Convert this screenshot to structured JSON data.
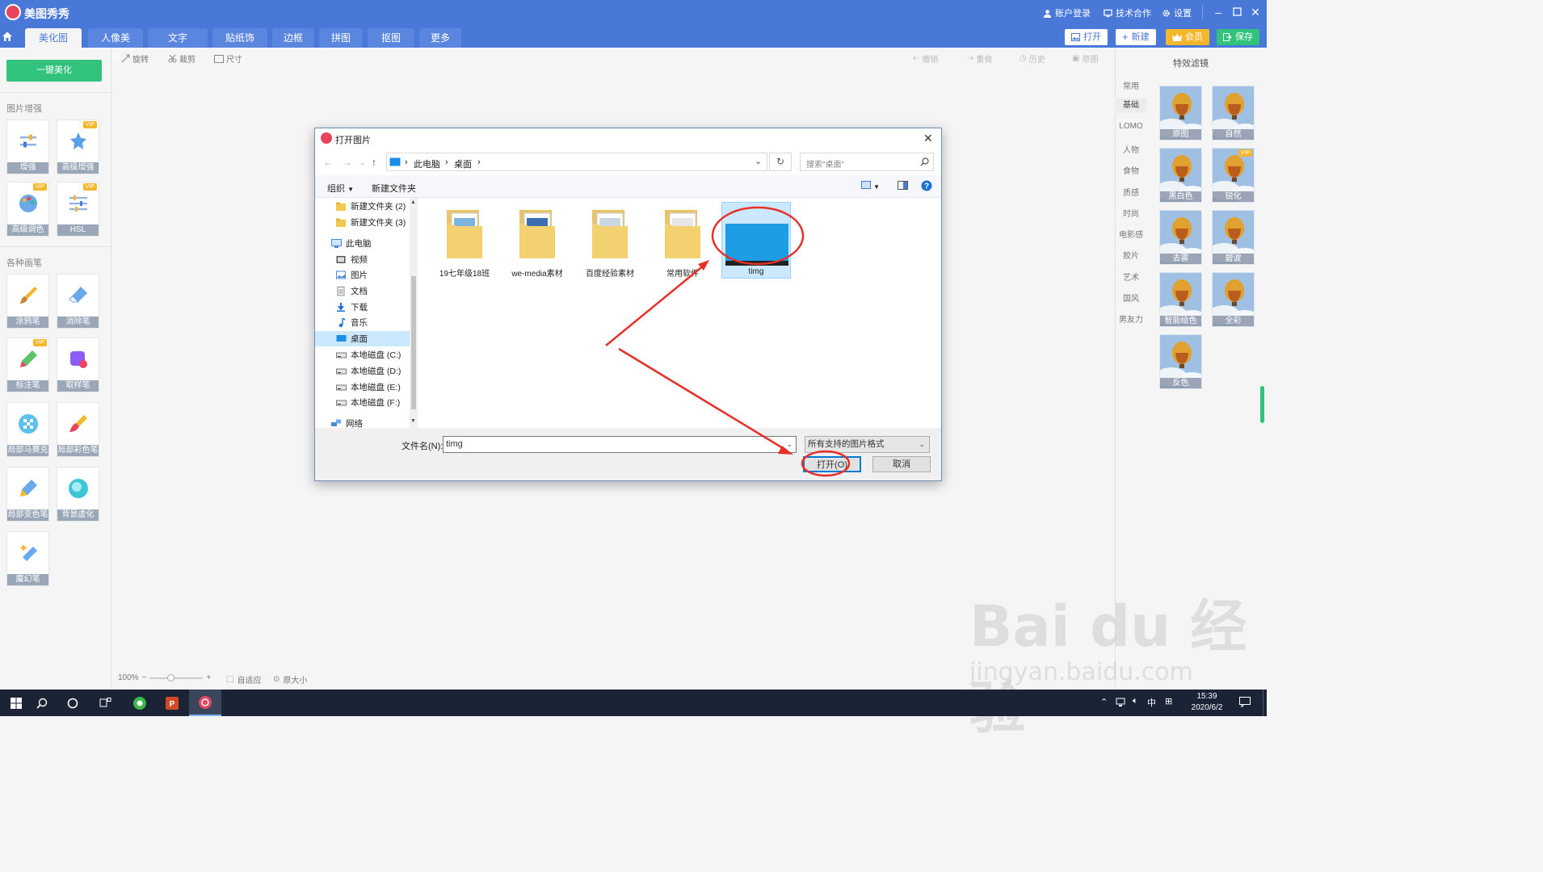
{
  "app": {
    "name": "美图秀秀",
    "account_login": "账户登录",
    "tech_coop": "技术合作",
    "settings": "设置"
  },
  "tabs": [
    "美化图片",
    "人像美容",
    "文字",
    "贴纸饰品",
    "边框",
    "拼图",
    "抠图",
    "更多"
  ],
  "top_buttons": {
    "open": "打开",
    "new": "新建",
    "vip": "会员",
    "save": "保存"
  },
  "toolbar": {
    "rotate": "旋转",
    "crop": "裁剪",
    "size": "尺寸",
    "undo": "撤销",
    "redo": "重做",
    "history": "历史",
    "original": "原图"
  },
  "left_panel": {
    "one_click": "一键美化",
    "section_enhance": "图片增强",
    "section_brush": "各种画笔",
    "enhance_tools": [
      {
        "label": "增强",
        "icon": "sliders-icon",
        "vip": false
      },
      {
        "label": "高级增强",
        "icon": "star-wand-icon",
        "vip": true
      },
      {
        "label": "高级调色",
        "icon": "palette-icon",
        "vip": true
      },
      {
        "label": "HSL",
        "icon": "hsl-sliders-icon",
        "vip": true
      }
    ],
    "brush_tools": [
      {
        "label": "涂鸦笔",
        "icon": "brush-icon",
        "vip": false
      },
      {
        "label": "消除笔",
        "icon": "eraser-icon",
        "vip": false
      },
      {
        "label": "标注笔",
        "icon": "marker-icon",
        "vip": true
      },
      {
        "label": "取样笔",
        "icon": "sample-icon",
        "vip": false
      },
      {
        "label": "局部马赛克",
        "icon": "mosaic-icon",
        "vip": false
      },
      {
        "label": "局部彩色笔",
        "icon": "color-brush-icon",
        "vip": false
      },
      {
        "label": "局部变色笔",
        "icon": "recolor-icon",
        "vip": false
      },
      {
        "label": "背景虚化",
        "icon": "blur-icon",
        "vip": false
      },
      {
        "label": "魔幻笔",
        "icon": "magic-pen-icon",
        "vip": false
      }
    ],
    "vip_tag": "VIP"
  },
  "right_panel": {
    "title": "特效滤镜",
    "categories": [
      "常用",
      "基础",
      "LOMO",
      "人物",
      "食物",
      "质感",
      "时尚",
      "电影感",
      "胶片",
      "艺术",
      "国风",
      "男友力"
    ],
    "active_category": "基础",
    "filters": [
      {
        "label": "原图",
        "vip": false
      },
      {
        "label": "自然",
        "vip": false
      },
      {
        "label": "黑白色",
        "vip": false
      },
      {
        "label": "锐化",
        "vip": true
      },
      {
        "label": "去雾",
        "vip": false
      },
      {
        "label": "碧波",
        "vip": false
      },
      {
        "label": "智能绘色",
        "vip": false
      },
      {
        "label": "全彩",
        "vip": false
      },
      {
        "label": "反色",
        "vip": false
      }
    ]
  },
  "zoom": {
    "percent": "100%",
    "minus": "−",
    "plus": "+",
    "fit": "自适应",
    "actual": "原大小"
  },
  "dialog": {
    "title": "打开图片",
    "path": [
      "此电脑",
      "桌面"
    ],
    "search_placeholder": "搜索\"桌面\"",
    "organize": "组织",
    "new_folder": "新建文件夹",
    "nav_items": [
      {
        "label": "新建文件夹 (2)",
        "icon": "folder-icon",
        "indent": 1
      },
      {
        "label": "新建文件夹 (3)",
        "icon": "folder-icon",
        "indent": 1
      },
      {
        "label": "此电脑",
        "icon": "computer-icon",
        "indent": 0
      },
      {
        "label": "视频",
        "icon": "video-icon",
        "indent": 1
      },
      {
        "label": "图片",
        "icon": "pictures-icon",
        "indent": 1
      },
      {
        "label": "文档",
        "icon": "document-icon",
        "indent": 1
      },
      {
        "label": "下载",
        "icon": "download-icon",
        "indent": 1
      },
      {
        "label": "音乐",
        "icon": "music-icon",
        "indent": 1
      },
      {
        "label": "桌面",
        "icon": "desktop-icon",
        "indent": 1,
        "selected": true
      },
      {
        "label": "本地磁盘 (C:)",
        "icon": "drive-icon",
        "indent": 1
      },
      {
        "label": "本地磁盘 (D:)",
        "icon": "drive-icon",
        "indent": 1
      },
      {
        "label": "本地磁盘 (E:)",
        "icon": "drive-icon",
        "indent": 1
      },
      {
        "label": "本地磁盘 (F:)",
        "icon": "drive-icon",
        "indent": 1
      },
      {
        "label": "网络",
        "icon": "network-icon",
        "indent": 0
      }
    ],
    "files": [
      {
        "name": "19七年级18班",
        "type": "folder"
      },
      {
        "name": "we-media素材",
        "type": "folder"
      },
      {
        "name": "百度经验素材",
        "type": "folder"
      },
      {
        "name": "常用软件",
        "type": "folder"
      },
      {
        "name": "timg",
        "type": "image",
        "selected": true
      }
    ],
    "filename_label": "文件名(N):",
    "filename_value": "timg",
    "filetype_value": "所有支持的图片格式",
    "open_button": "打开(O)",
    "cancel_button": "取消"
  },
  "taskbar": {
    "time": "15:39",
    "date": "2020/6/2",
    "ime": "中"
  },
  "watermark": {
    "line1": "Bai du 经验",
    "line2": "jingyan.baidu.com"
  },
  "colors": {
    "brand": "#4a78d8",
    "accent_green": "#31c27c",
    "vip_gold": "#f4b62a",
    "annotation_red": "#e8302a",
    "selection": "#cce8ff"
  }
}
